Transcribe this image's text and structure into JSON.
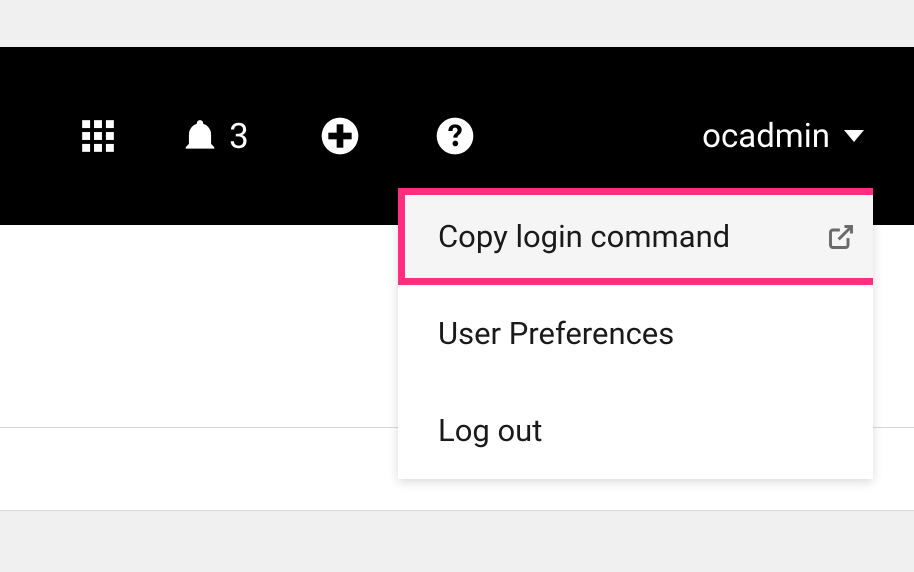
{
  "topbar": {
    "notification_count": "3",
    "username": "ocadmin"
  },
  "dropdown": {
    "items": [
      {
        "label": "Copy login command",
        "external": true,
        "highlighted": true
      },
      {
        "label": "User Preferences",
        "external": false,
        "highlighted": false
      },
      {
        "label": "Log out",
        "external": false,
        "highlighted": false
      }
    ]
  }
}
